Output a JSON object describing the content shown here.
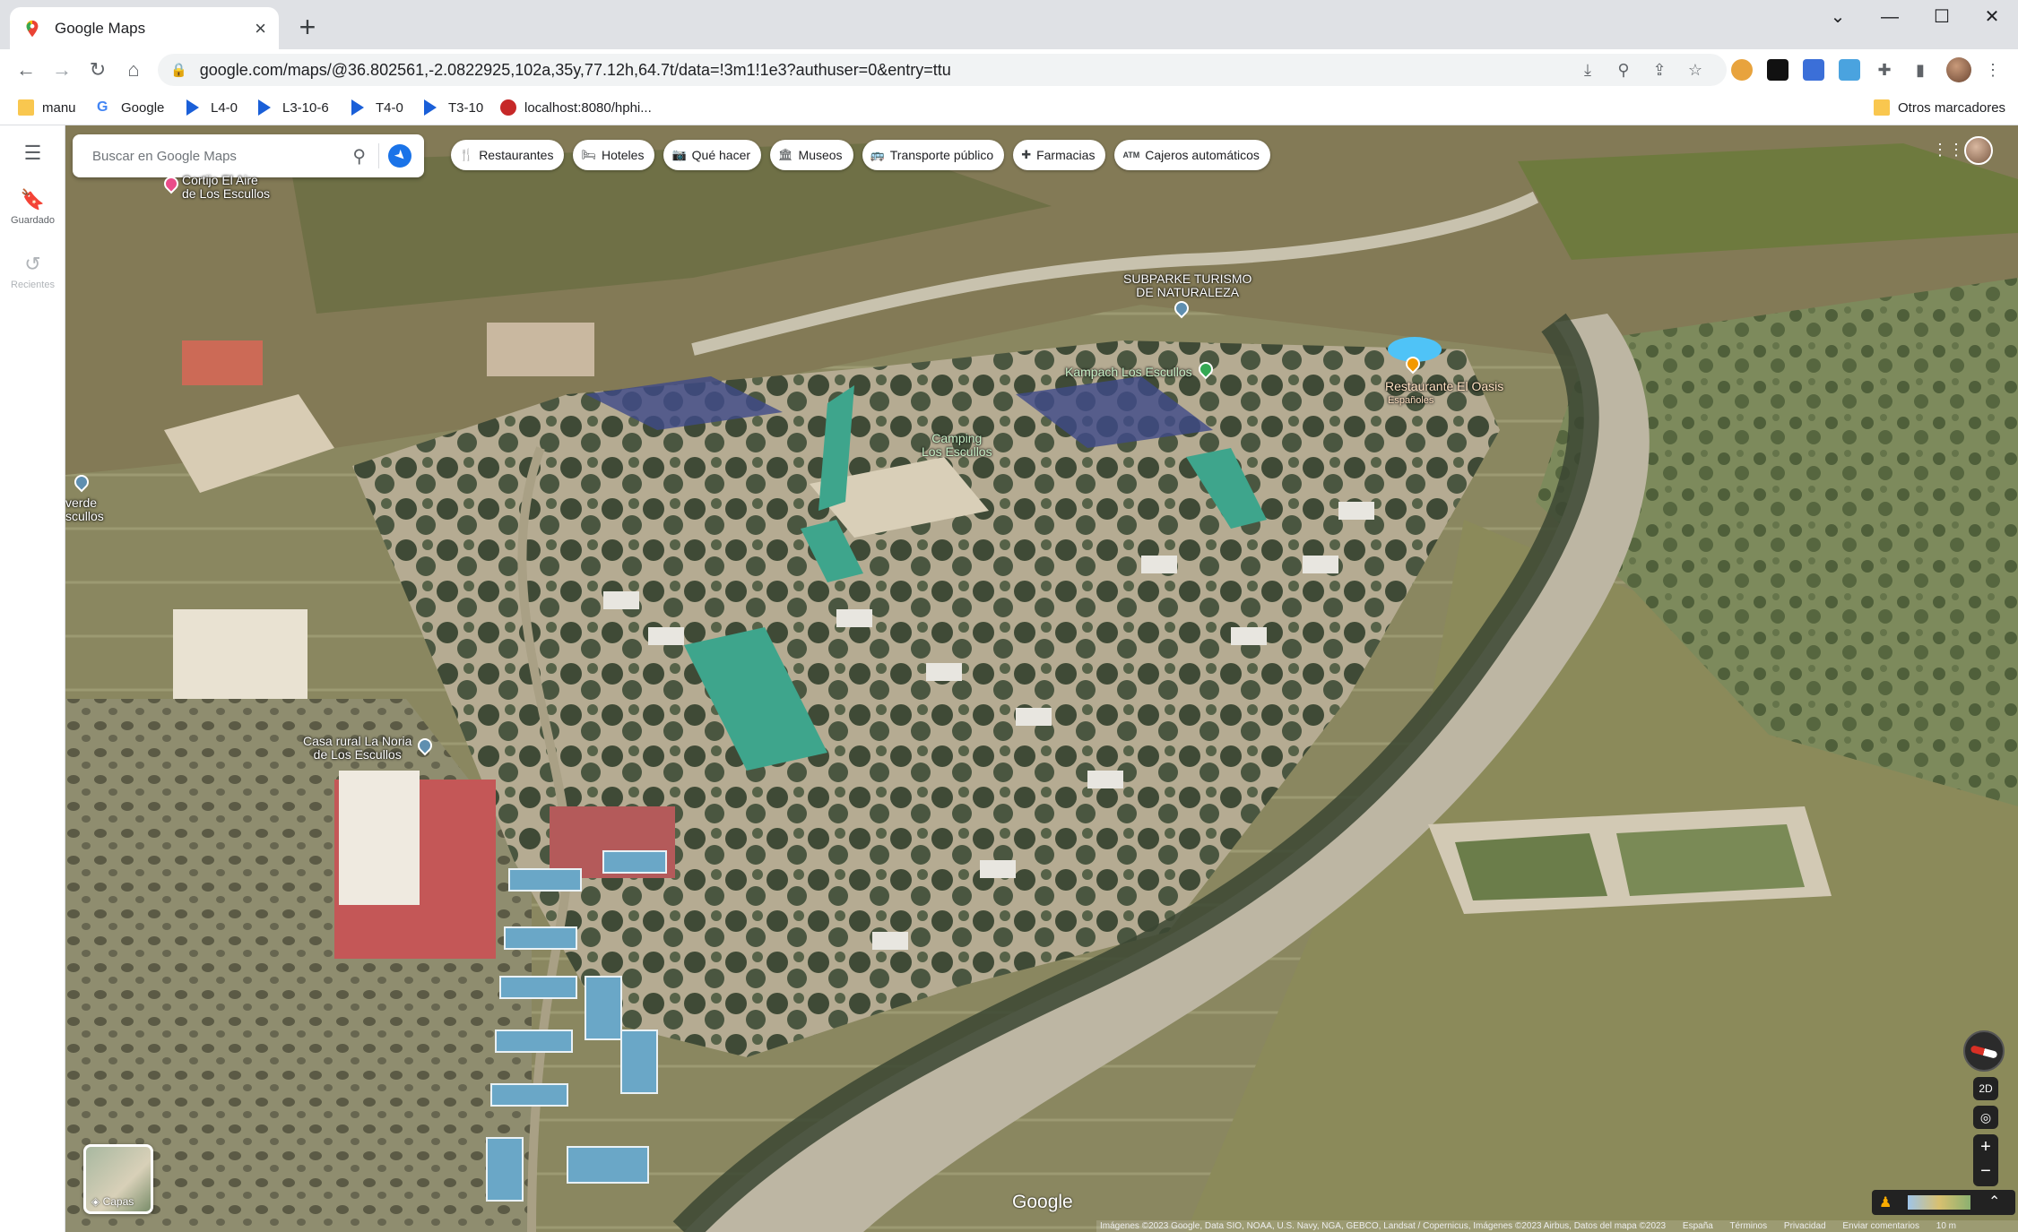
{
  "browser": {
    "tab_title": "Google Maps",
    "new_tab": "+",
    "url": "google.com/maps/@36.802561,-2.0822925,102a,35y,77.12h,64.7t/data=!3m1!1e3?authuser=0&entry=ttu",
    "bookmarks": [
      {
        "label": "manu",
        "icon": "folder-icon"
      },
      {
        "label": "Google",
        "icon": "google-icon"
      },
      {
        "label": "L4-0",
        "icon": "flag-icon"
      },
      {
        "label": "L3-10-6",
        "icon": "flag-icon"
      },
      {
        "label": "T4-0",
        "icon": "flag-icon"
      },
      {
        "label": "T3-10",
        "icon": "flag-icon"
      },
      {
        "label": "localhost:8080/hphi...",
        "icon": "site-icon"
      }
    ],
    "other_bookmarks": "Otros marcadores"
  },
  "rail": {
    "saved": "Guardado",
    "recent": "Recientes"
  },
  "map": {
    "search_placeholder": "Buscar en Google Maps",
    "chips": [
      {
        "label": "Restaurantes",
        "icon": "🍴"
      },
      {
        "label": "Hoteles",
        "icon": "🛏"
      },
      {
        "label": "Qué hacer",
        "icon": "📷"
      },
      {
        "label": "Museos",
        "icon": "🏛"
      },
      {
        "label": "Transporte público",
        "icon": "🚌"
      },
      {
        "label": "Farmacias",
        "icon": "✚"
      },
      {
        "label": "Cajeros automáticos",
        "icon": "ATM"
      }
    ],
    "places": {
      "cortijo": "Cortijo El Aire\nde Los Escullos",
      "subparke": "SUBPARKE TURISMO\nDE NATURALEZA",
      "kampach": "Kampach Los Escullos",
      "camping": "Camping\nLos Escullos",
      "restaurante": "Restaurante El Oasis",
      "restaurante_sub": "Españoles",
      "verde": "verde\nscullos",
      "noria": "Casa rural La Noria\nde Los Escullos"
    },
    "layers_label": "Capas",
    "view_2d": "2D",
    "zoom_in": "+",
    "zoom_out": "−",
    "google_logo": "Google",
    "attribution": [
      "Imágenes ©2023 Google, Data SIO, NOAA, U.S. Navy, NGA, GEBCO, Landsat / Copernicus, Imágenes ©2023 Airbus, Datos del mapa ©2023",
      "España",
      "Términos",
      "Privacidad",
      "Enviar comentarios",
      "10 m"
    ]
  }
}
